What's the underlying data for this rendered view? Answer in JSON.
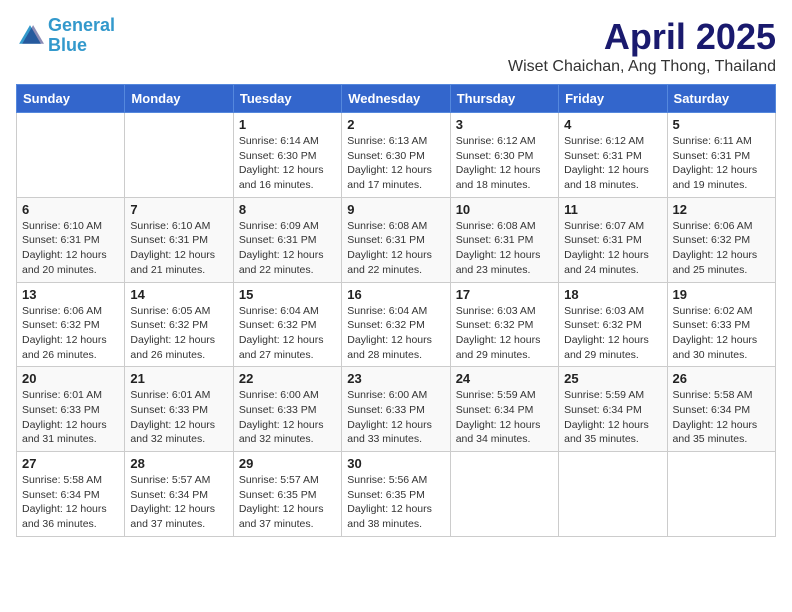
{
  "header": {
    "logo_line1": "General",
    "logo_line2": "Blue",
    "title": "April 2025",
    "subtitle": "Wiset Chaichan, Ang Thong, Thailand"
  },
  "days_of_week": [
    "Sunday",
    "Monday",
    "Tuesday",
    "Wednesday",
    "Thursday",
    "Friday",
    "Saturday"
  ],
  "weeks": [
    [
      {
        "day": "",
        "info": ""
      },
      {
        "day": "",
        "info": ""
      },
      {
        "day": "1",
        "info": "Sunrise: 6:14 AM\nSunset: 6:30 PM\nDaylight: 12 hours and 16 minutes."
      },
      {
        "day": "2",
        "info": "Sunrise: 6:13 AM\nSunset: 6:30 PM\nDaylight: 12 hours and 17 minutes."
      },
      {
        "day": "3",
        "info": "Sunrise: 6:12 AM\nSunset: 6:30 PM\nDaylight: 12 hours and 18 minutes."
      },
      {
        "day": "4",
        "info": "Sunrise: 6:12 AM\nSunset: 6:31 PM\nDaylight: 12 hours and 18 minutes."
      },
      {
        "day": "5",
        "info": "Sunrise: 6:11 AM\nSunset: 6:31 PM\nDaylight: 12 hours and 19 minutes."
      }
    ],
    [
      {
        "day": "6",
        "info": "Sunrise: 6:10 AM\nSunset: 6:31 PM\nDaylight: 12 hours and 20 minutes."
      },
      {
        "day": "7",
        "info": "Sunrise: 6:10 AM\nSunset: 6:31 PM\nDaylight: 12 hours and 21 minutes."
      },
      {
        "day": "8",
        "info": "Sunrise: 6:09 AM\nSunset: 6:31 PM\nDaylight: 12 hours and 22 minutes."
      },
      {
        "day": "9",
        "info": "Sunrise: 6:08 AM\nSunset: 6:31 PM\nDaylight: 12 hours and 22 minutes."
      },
      {
        "day": "10",
        "info": "Sunrise: 6:08 AM\nSunset: 6:31 PM\nDaylight: 12 hours and 23 minutes."
      },
      {
        "day": "11",
        "info": "Sunrise: 6:07 AM\nSunset: 6:31 PM\nDaylight: 12 hours and 24 minutes."
      },
      {
        "day": "12",
        "info": "Sunrise: 6:06 AM\nSunset: 6:32 PM\nDaylight: 12 hours and 25 minutes."
      }
    ],
    [
      {
        "day": "13",
        "info": "Sunrise: 6:06 AM\nSunset: 6:32 PM\nDaylight: 12 hours and 26 minutes."
      },
      {
        "day": "14",
        "info": "Sunrise: 6:05 AM\nSunset: 6:32 PM\nDaylight: 12 hours and 26 minutes."
      },
      {
        "day": "15",
        "info": "Sunrise: 6:04 AM\nSunset: 6:32 PM\nDaylight: 12 hours and 27 minutes."
      },
      {
        "day": "16",
        "info": "Sunrise: 6:04 AM\nSunset: 6:32 PM\nDaylight: 12 hours and 28 minutes."
      },
      {
        "day": "17",
        "info": "Sunrise: 6:03 AM\nSunset: 6:32 PM\nDaylight: 12 hours and 29 minutes."
      },
      {
        "day": "18",
        "info": "Sunrise: 6:03 AM\nSunset: 6:32 PM\nDaylight: 12 hours and 29 minutes."
      },
      {
        "day": "19",
        "info": "Sunrise: 6:02 AM\nSunset: 6:33 PM\nDaylight: 12 hours and 30 minutes."
      }
    ],
    [
      {
        "day": "20",
        "info": "Sunrise: 6:01 AM\nSunset: 6:33 PM\nDaylight: 12 hours and 31 minutes."
      },
      {
        "day": "21",
        "info": "Sunrise: 6:01 AM\nSunset: 6:33 PM\nDaylight: 12 hours and 32 minutes."
      },
      {
        "day": "22",
        "info": "Sunrise: 6:00 AM\nSunset: 6:33 PM\nDaylight: 12 hours and 32 minutes."
      },
      {
        "day": "23",
        "info": "Sunrise: 6:00 AM\nSunset: 6:33 PM\nDaylight: 12 hours and 33 minutes."
      },
      {
        "day": "24",
        "info": "Sunrise: 5:59 AM\nSunset: 6:34 PM\nDaylight: 12 hours and 34 minutes."
      },
      {
        "day": "25",
        "info": "Sunrise: 5:59 AM\nSunset: 6:34 PM\nDaylight: 12 hours and 35 minutes."
      },
      {
        "day": "26",
        "info": "Sunrise: 5:58 AM\nSunset: 6:34 PM\nDaylight: 12 hours and 35 minutes."
      }
    ],
    [
      {
        "day": "27",
        "info": "Sunrise: 5:58 AM\nSunset: 6:34 PM\nDaylight: 12 hours and 36 minutes."
      },
      {
        "day": "28",
        "info": "Sunrise: 5:57 AM\nSunset: 6:34 PM\nDaylight: 12 hours and 37 minutes."
      },
      {
        "day": "29",
        "info": "Sunrise: 5:57 AM\nSunset: 6:35 PM\nDaylight: 12 hours and 37 minutes."
      },
      {
        "day": "30",
        "info": "Sunrise: 5:56 AM\nSunset: 6:35 PM\nDaylight: 12 hours and 38 minutes."
      },
      {
        "day": "",
        "info": ""
      },
      {
        "day": "",
        "info": ""
      },
      {
        "day": "",
        "info": ""
      }
    ]
  ]
}
